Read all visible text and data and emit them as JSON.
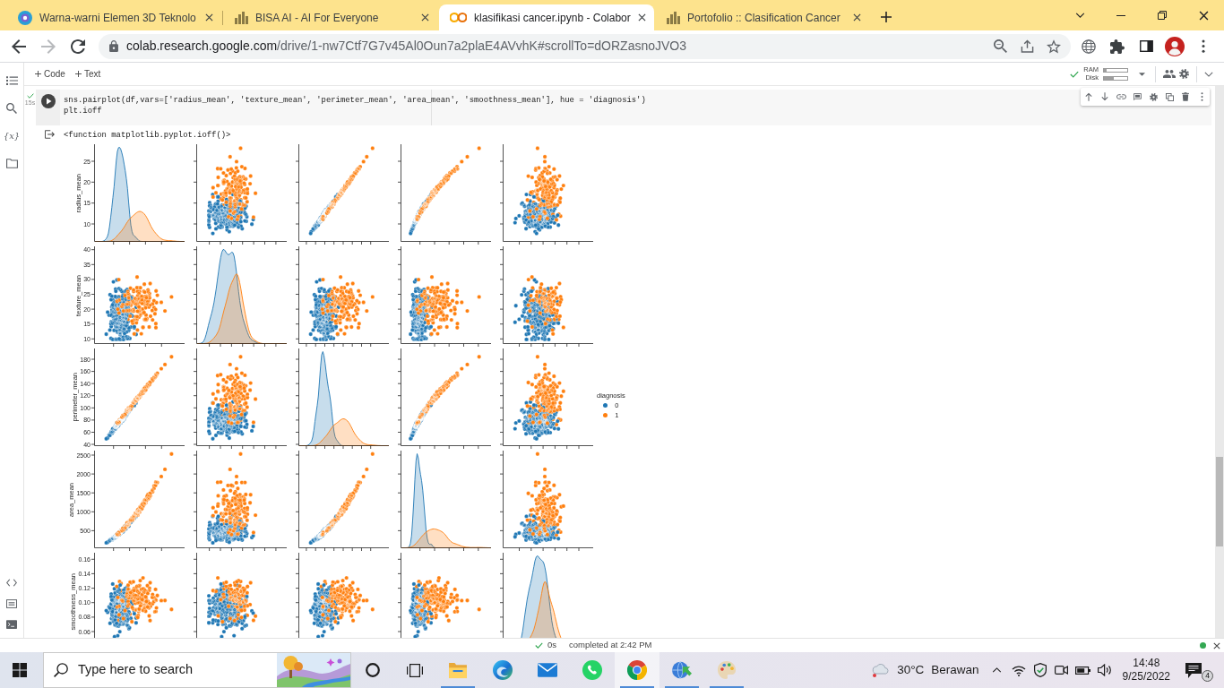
{
  "browser": {
    "tabs": [
      {
        "title": "Warna-warni Elemen 3D Teknolo",
        "kind": "circle",
        "selected": false
      },
      {
        "title": "BISA AI - AI For Everyone",
        "kind": "bars",
        "selected": false
      },
      {
        "title": "klasifikasi cancer.ipynb - Colabor",
        "kind": "rings",
        "selected": true
      },
      {
        "title": "Portofolio :: Clasification Cancer",
        "kind": "bars",
        "selected": false
      }
    ],
    "forward": {
      "disabled": true
    },
    "address": {
      "host": "colab.research.google.com",
      "path": "/drive/1-nw7Ctf7G7v45Al0Oun7a2plaE4AVvhK#scrollTo=dORZasnoJVO3"
    }
  },
  "colab": {
    "sidebar": {
      "variables_label": "{x}"
    },
    "toolbar": {
      "insert": [
        {
          "label": "Code"
        },
        {
          "label": "Text"
        }
      ],
      "connected": true,
      "resources": [
        {
          "label": "RAM",
          "level": 0.12
        },
        {
          "label": "Disk",
          "level": 0.42
        }
      ]
    },
    "cell": {
      "done": true,
      "elapsed": "15s",
      "code": [
        "sns.pairplot(df,vars=['radius_mean', 'texture_mean', 'perimeter_mean', 'area_mean', 'smoothness_mean'], hue = 'diagnosis')",
        "plt.ioff"
      ],
      "output": "<function matplotlib.pyplot.ioff()>"
    },
    "pairplot": {
      "variables": [
        {
          "name": "radius_mean",
          "ticks": [
            "25",
            "20",
            "15",
            "10"
          ]
        },
        {
          "name": "texture_mean",
          "ticks": [
            "40",
            "35",
            "30",
            "25",
            "20",
            "15",
            "10"
          ]
        },
        {
          "name": "perimeter_mean",
          "ticks": [
            "180",
            "160",
            "140",
            "120",
            "100",
            "80",
            "60",
            "40"
          ]
        },
        {
          "name": "area_mean",
          "ticks": [
            "2500",
            "2000",
            "1500",
            "1000",
            "500"
          ]
        },
        {
          "name": "smoothness_mean",
          "ticks": [
            "0.16",
            "0.14",
            "0.12",
            "0.10",
            "0.08",
            "0.06"
          ]
        }
      ],
      "legend": {
        "title": "diagnosis",
        "items": [
          {
            "label": "0",
            "color": "#1f77b4"
          },
          {
            "label": "1",
            "color": "#ff7f0e"
          }
        ]
      }
    },
    "status_bar": {
      "done": true,
      "duration": "0s",
      "message": "completed at 2:42 PM",
      "connected": true
    }
  },
  "taskbar": {
    "search": {
      "placeholder": "Type here to search"
    },
    "apps": [
      {
        "kind": "folder",
        "running": true,
        "selected": false
      },
      {
        "kind": "swirl",
        "running": false,
        "selected": false
      },
      {
        "kind": "envelope",
        "running": false,
        "selected": false
      },
      {
        "kind": "chat",
        "running": false,
        "selected": false
      },
      {
        "kind": "tricolor",
        "running": true,
        "selected": true
      },
      {
        "kind": "globe",
        "running": true,
        "selected": false
      },
      {
        "kind": "palette",
        "running": true,
        "selected": false
      }
    ],
    "weather": {
      "temperature": "30°C",
      "condition": "Berawan"
    },
    "clock": {
      "time": "14:48",
      "date": "9/25/2022"
    },
    "notifications": {
      "count": "4"
    }
  }
}
